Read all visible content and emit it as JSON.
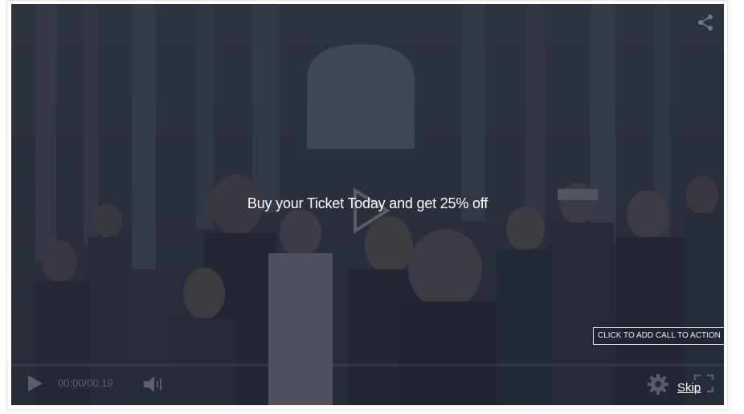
{
  "ad": {
    "headline": "Buy your Ticket Today and get 25% off",
    "cta_label": "CLICK TO ADD CALL TO ACTION",
    "skip_label": "Skip"
  },
  "controls": {
    "time_current": "00:00",
    "time_separator": "/",
    "time_total": "00:19"
  },
  "icons": {
    "share": "share-icon",
    "center_play": "play-icon",
    "control_play": "play-icon",
    "volume": "volume-icon",
    "settings": "gear-icon",
    "fullscreen": "fullscreen-icon"
  },
  "colors": {
    "overlay": "#1e2330",
    "text": "#ffffff",
    "cta_border": "#d7d9de"
  }
}
